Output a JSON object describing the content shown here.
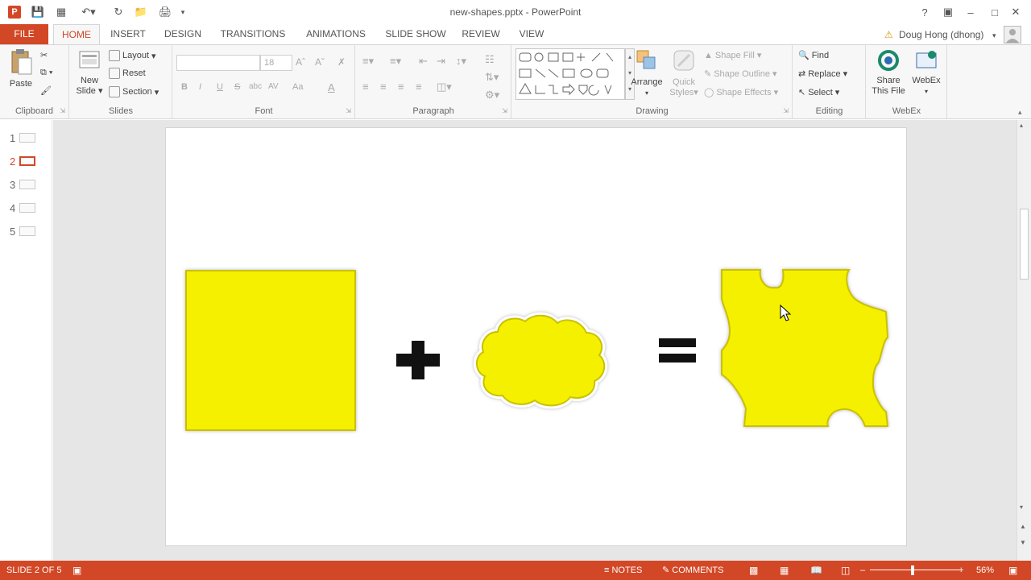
{
  "window": {
    "title": "new-shapes.pptx - PowerPoint",
    "help": "?",
    "account_user": "Doug Hong (dhong)"
  },
  "tabs": {
    "file": "FILE",
    "home": "HOME",
    "insert": "INSERT",
    "design": "DESIGN",
    "transitions": "TRANSITIONS",
    "animations": "ANIMATIONS",
    "slide_show": "SLIDE SHOW",
    "review": "REVIEW",
    "view": "VIEW"
  },
  "ribbon": {
    "clipboard": {
      "label": "Clipboard",
      "paste": "Paste"
    },
    "slides": {
      "label": "Slides",
      "new_slide_1": "New",
      "new_slide_2": "Slide",
      "layout": "Layout",
      "reset": "Reset",
      "section": "Section"
    },
    "font": {
      "label": "Font",
      "font_size": "18",
      "bold": "B",
      "italic": "I",
      "underline": "U",
      "strike": "S",
      "shadow": "abc",
      "spacing": "AV",
      "case": "Aa",
      "color": "A"
    },
    "paragraph": {
      "label": "Paragraph"
    },
    "drawing": {
      "label": "Drawing",
      "arrange": "Arrange",
      "quick_styles_1": "Quick",
      "quick_styles_2": "Styles",
      "shape_fill": "Shape Fill",
      "shape_outline": "Shape Outline",
      "shape_effects": "Shape Effects"
    },
    "editing": {
      "label": "Editing",
      "find": "Find",
      "replace": "Replace",
      "select": "Select"
    },
    "webex": {
      "label": "WebEx",
      "share_1": "Share",
      "share_2": "This File",
      "webex": "WebEx"
    }
  },
  "thumbnails": [
    "1",
    "2",
    "3",
    "4",
    "5"
  ],
  "slide": {
    "plus": "+",
    "equals": "="
  },
  "status": {
    "slide_pos": "SLIDE 2 OF 5",
    "notes": "NOTES",
    "comments": "COMMENTS",
    "zoom": "56%"
  },
  "colors": {
    "accent": "#d24726",
    "shape_fill": "#f5f000",
    "shape_edge": "#c9c100"
  }
}
